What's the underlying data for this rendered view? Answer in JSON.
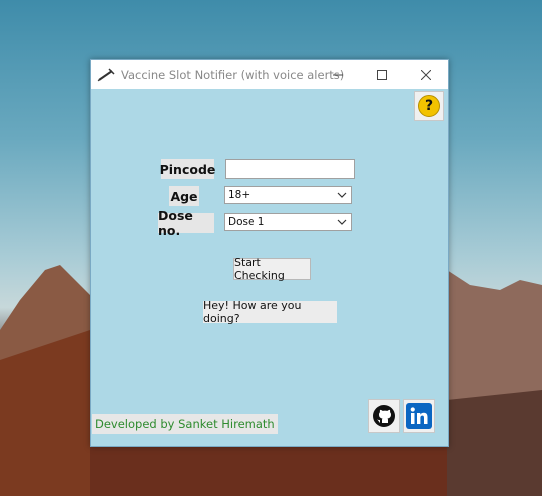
{
  "window": {
    "title": "Vaccine Slot Notifier (with voice alerts)",
    "controls": {
      "minimize": "—",
      "maximize": "☐",
      "close": "✕"
    }
  },
  "help": {
    "label": "?"
  },
  "form": {
    "pincode": {
      "label": "Pincode",
      "value": ""
    },
    "age": {
      "label": "Age",
      "selected": "18+"
    },
    "dose": {
      "label": "Dose no.",
      "selected": "Dose 1"
    }
  },
  "buttons": {
    "start": "Start Checking",
    "greeting": "Hey! How are you doing?"
  },
  "footer": {
    "credit": "Developed by Sanket Hiremath"
  },
  "icons": {
    "app": "syringe-icon",
    "help": "help-icon",
    "github": "github-icon",
    "linkedin": "linkedin-icon"
  },
  "colors": {
    "window_bg": "#add8e6",
    "credit_text": "#2e8b2e",
    "linkedin": "#0a66c2",
    "help": "#f2c200"
  }
}
